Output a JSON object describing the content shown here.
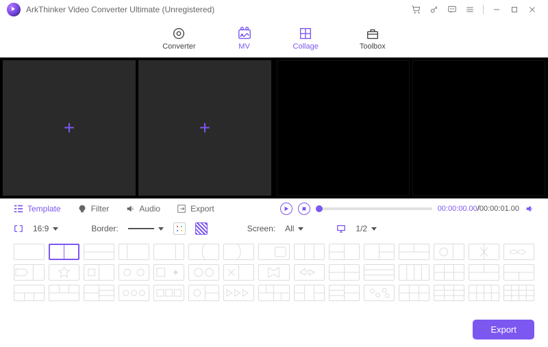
{
  "app": {
    "title": "ArkThinker Video Converter Ultimate (Unregistered)"
  },
  "topnav": {
    "converter": "Converter",
    "mv": "MV",
    "collage": "Collage",
    "toolbox": "Toolbox"
  },
  "section": {
    "template": "Template",
    "filter": "Filter",
    "audio": "Audio",
    "export": "Export"
  },
  "playback": {
    "current": "00:00:00.00",
    "total": "00:00:01.00"
  },
  "opts": {
    "ratio": "16:9",
    "border_label": "Border:",
    "screen_label": "Screen:",
    "screen_value": "All",
    "page": "1/2"
  },
  "buttons": {
    "export": "Export"
  }
}
